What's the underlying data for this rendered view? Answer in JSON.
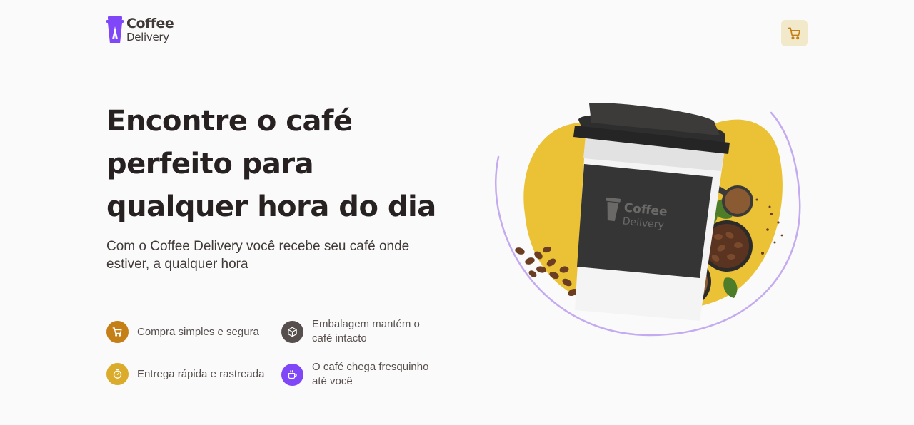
{
  "header": {
    "logo": {
      "line1": "Coffee",
      "line2": "Delivery"
    },
    "cart_icon": "shopping-cart-icon"
  },
  "hero": {
    "title": "Encontre o café perfeito para qualquer hora do dia",
    "subtitle": "Com o Coffee Delivery você recebe seu café onde estiver, a qualquer hora",
    "image": {
      "cup_logo_line1": "Coffee",
      "cup_logo_line2": "Delivery"
    }
  },
  "features": [
    {
      "icon": "shopping-cart-icon",
      "color": "#c47f17",
      "text": "Compra simples e segura"
    },
    {
      "icon": "package-icon",
      "color": "#574f4d",
      "text": "Embalagem mantém o café intacto"
    },
    {
      "icon": "timer-icon",
      "color": "#dbac2c",
      "text": "Entrega rápida e rastreada"
    },
    {
      "icon": "coffee-icon",
      "color": "#8047f8",
      "text": "O café chega fresquinho até você"
    }
  ],
  "colors": {
    "brand_purple": "#8047f8",
    "yellow": "#dbac2c",
    "yellow_dark": "#c47f17",
    "yellow_light": "#f1e9c9",
    "title": "#272221",
    "text": "#403937"
  }
}
